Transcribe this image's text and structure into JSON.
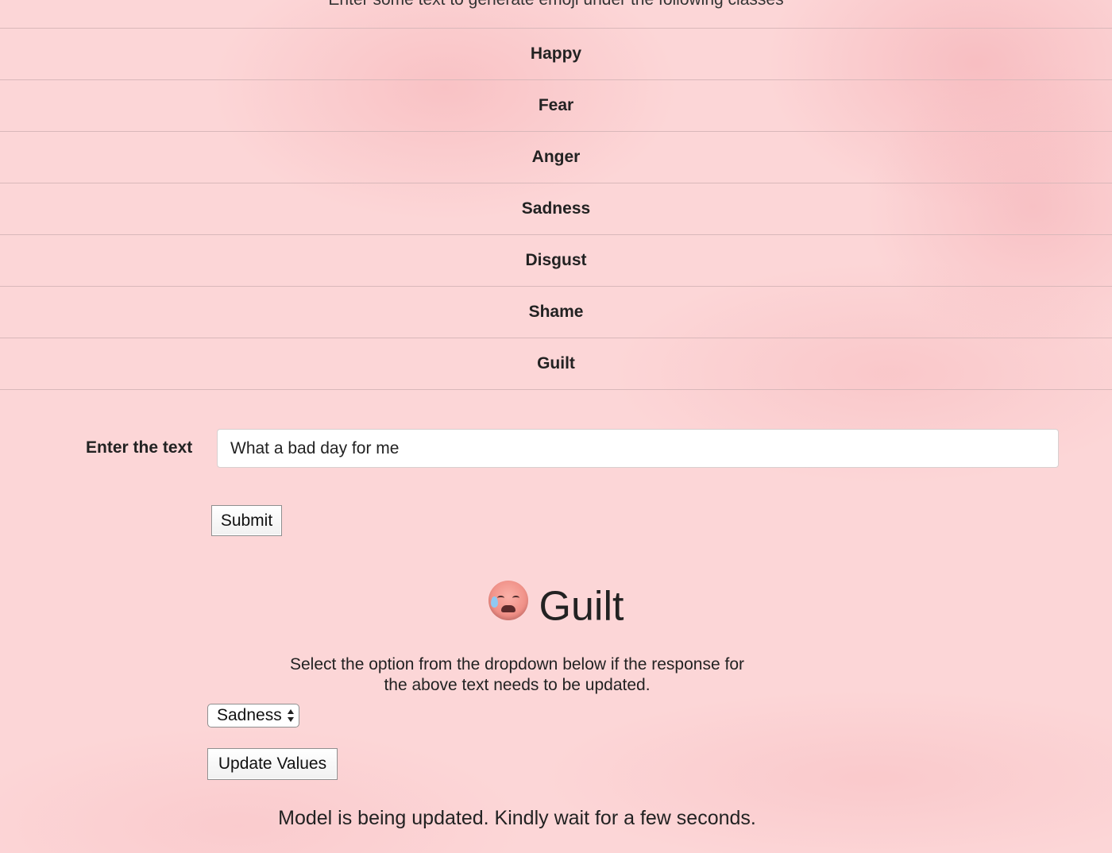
{
  "intro": "Enter some text to generate emoji under the following classes",
  "classes": [
    "Happy",
    "Fear",
    "Anger",
    "Sadness",
    "Disgust",
    "Shame",
    "Guilt"
  ],
  "form": {
    "label": "Enter the text",
    "input_value": "What a bad day for me",
    "submit_label": "Submit"
  },
  "result": {
    "emoji_icon": "face-with-sweat-emoji-icon",
    "label": "Guilt"
  },
  "instruction": "Select the option from the dropdown below if the response for the above text needs to be updated.",
  "dropdown": {
    "selected": "Sadness"
  },
  "update_label": "Update Values",
  "status": "Model is being updated. Kindly wait for a few seconds."
}
